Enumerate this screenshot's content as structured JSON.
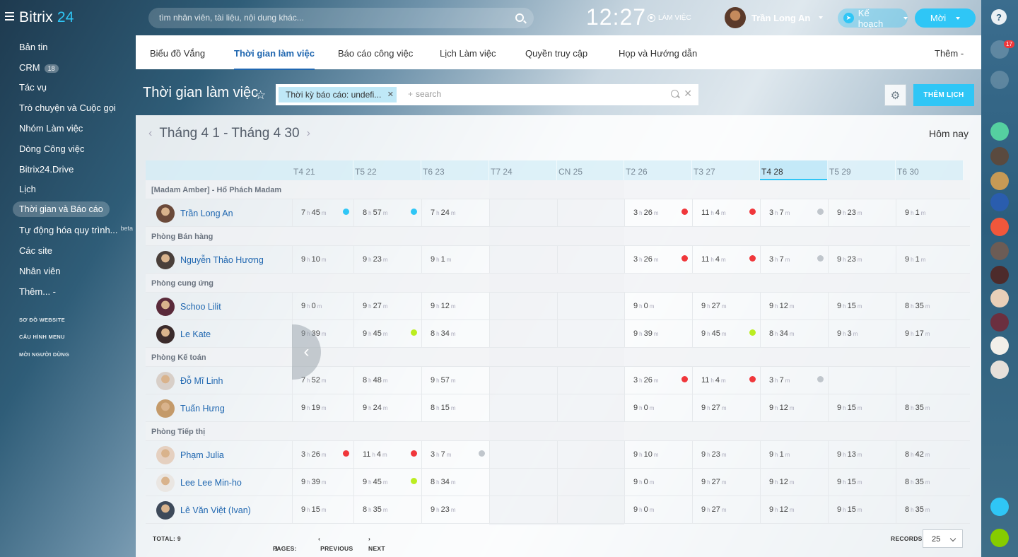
{
  "app": {
    "logo_main": "Bitrix",
    "logo_num": "24"
  },
  "top": {
    "search_placeholder": "tìm nhân viên, tài liệu, nội dung khác...",
    "clock": "12:27",
    "work_status": "LÀM VIỆC",
    "user_name": "Trần Long An",
    "plan_label": "Kế hoạch",
    "new_label": "Mời",
    "help_label": "?",
    "notif_count": "17"
  },
  "menu": {
    "items": [
      {
        "label": "Bản tin"
      },
      {
        "label": "CRM",
        "badge": "18"
      },
      {
        "label": "Tác vụ"
      },
      {
        "label": "Trò chuyện và Cuộc gọi"
      },
      {
        "label": "Nhóm Làm việc"
      },
      {
        "label": "Dòng Công việc"
      },
      {
        "label": "Bitrix24.Drive"
      },
      {
        "label": "Lịch"
      },
      {
        "label": "Thời gian và Báo cáo"
      },
      {
        "label": "Tự động hóa quy trình...",
        "beta": "beta"
      },
      {
        "label": "Các site"
      },
      {
        "label": "Nhân viên"
      },
      {
        "label": "Thêm... -"
      }
    ],
    "small": [
      "SƠ ĐỒ WEBSITE",
      "CẤU HÌNH MENU",
      "MỜI NGƯỜI DÙNG"
    ]
  },
  "tabs": [
    "Biểu đồ Vắng",
    "Thời gian làm việc",
    "Báo cáo công việc",
    "Lịch Làm việc",
    "Quyền truy cập",
    "Họp và Hướng dẫn",
    "Thêm -"
  ],
  "page": {
    "title": "Thời gian làm việc",
    "filter_chip": "Thời kỳ báo cáo: undefi...",
    "filter_placeholder": "search",
    "add_button": "THÊM LỊCH",
    "range": "Tháng 4 1 - Tháng 4 30",
    "today": "Hôm nay"
  },
  "days": [
    "T4 21",
    "T5 22",
    "T6 23",
    "T7 24",
    "CN 25",
    "T2 26",
    "T3 27",
    "T4 28",
    "T5 29",
    "T6 30"
  ],
  "groups": [
    {
      "name": "[Madam Amber] - Hổ Phách Madam",
      "employees": [
        {
          "name": "Trần Long An",
          "cells": [
            [
              "7",
              "45",
              "blue"
            ],
            [
              "8",
              "57",
              "blue"
            ],
            [
              "7",
              "24",
              ""
            ],
            null,
            null,
            [
              "3",
              "26",
              "red"
            ],
            [
              "11",
              "4",
              "red"
            ],
            [
              "3",
              "7",
              "gray"
            ],
            [
              "9",
              "23",
              ""
            ],
            [
              "9",
              "1",
              ""
            ]
          ]
        }
      ]
    },
    {
      "name": "Phòng Bán hàng",
      "employees": [
        {
          "name": "Nguyễn Thảo Hương",
          "cells": [
            [
              "9",
              "10",
              ""
            ],
            [
              "9",
              "23",
              ""
            ],
            [
              "9",
              "1",
              ""
            ],
            null,
            null,
            [
              "3",
              "26",
              "red"
            ],
            [
              "11",
              "4",
              "red"
            ],
            [
              "3",
              "7",
              "gray"
            ],
            [
              "9",
              "23",
              ""
            ],
            [
              "9",
              "1",
              ""
            ]
          ]
        }
      ]
    },
    {
      "name": "Phòng cung ứng",
      "employees": [
        {
          "name": "Schoo Lilit",
          "cells": [
            [
              "9",
              "0",
              ""
            ],
            [
              "9",
              "27",
              ""
            ],
            [
              "9",
              "12",
              ""
            ],
            null,
            null,
            [
              "9",
              "0",
              ""
            ],
            [
              "9",
              "27",
              ""
            ],
            [
              "9",
              "12",
              ""
            ],
            [
              "9",
              "15",
              ""
            ],
            [
              "8",
              "35",
              ""
            ]
          ]
        },
        {
          "name": "Le Kate",
          "cells": [
            [
              "9",
              "39",
              ""
            ],
            [
              "9",
              "45",
              "lime"
            ],
            [
              "8",
              "34",
              ""
            ],
            null,
            null,
            [
              "9",
              "39",
              ""
            ],
            [
              "9",
              "45",
              "lime"
            ],
            [
              "8",
              "34",
              ""
            ],
            [
              "9",
              "3",
              ""
            ],
            [
              "9",
              "17",
              ""
            ]
          ]
        }
      ]
    },
    {
      "name": "Phòng Kế toán",
      "employees": [
        {
          "name": "Đỗ Mĩ Linh",
          "cells": [
            [
              "7",
              "52",
              ""
            ],
            [
              "8",
              "48",
              ""
            ],
            [
              "9",
              "57",
              ""
            ],
            null,
            null,
            [
              "3",
              "26",
              "red"
            ],
            [
              "11",
              "4",
              "red"
            ],
            [
              "3",
              "7",
              "gray"
            ],
            null,
            null
          ]
        },
        {
          "name": "Tuấn Hưng",
          "cells": [
            [
              "9",
              "19",
              ""
            ],
            [
              "9",
              "24",
              ""
            ],
            [
              "8",
              "15",
              ""
            ],
            null,
            null,
            [
              "9",
              "0",
              ""
            ],
            [
              "9",
              "27",
              ""
            ],
            [
              "9",
              "12",
              ""
            ],
            [
              "9",
              "15",
              ""
            ],
            [
              "8",
              "35",
              ""
            ]
          ]
        }
      ]
    },
    {
      "name": "Phòng Tiếp thị",
      "employees": [
        {
          "name": "Phạm Julia",
          "cells": [
            [
              "3",
              "26",
              "red"
            ],
            [
              "11",
              "4",
              "red"
            ],
            [
              "3",
              "7",
              "gray"
            ],
            null,
            null,
            [
              "9",
              "10",
              ""
            ],
            [
              "9",
              "23",
              ""
            ],
            [
              "9",
              "1",
              ""
            ],
            [
              "9",
              "13",
              ""
            ],
            [
              "8",
              "42",
              ""
            ]
          ]
        },
        {
          "name": "Lee Lee Min-ho",
          "cells": [
            [
              "9",
              "39",
              ""
            ],
            [
              "9",
              "45",
              "lime"
            ],
            [
              "8",
              "34",
              ""
            ],
            null,
            null,
            [
              "9",
              "0",
              ""
            ],
            [
              "9",
              "27",
              ""
            ],
            [
              "9",
              "12",
              ""
            ],
            [
              "9",
              "15",
              ""
            ],
            [
              "8",
              "35",
              ""
            ]
          ]
        },
        {
          "name": "Lê Văn Việt (Ivan)",
          "cells": [
            [
              "9",
              "15",
              ""
            ],
            [
              "8",
              "35",
              ""
            ],
            [
              "9",
              "23",
              ""
            ],
            null,
            null,
            [
              "9",
              "0",
              ""
            ],
            [
              "9",
              "27",
              ""
            ],
            [
              "9",
              "12",
              ""
            ],
            [
              "9",
              "15",
              ""
            ],
            [
              "8",
              "35",
              ""
            ]
          ]
        }
      ]
    }
  ],
  "units": {
    "h": "h",
    "m": "m"
  },
  "footer": {
    "total": "TOTAL: 9",
    "pages_label": "PAGES:",
    "pages": "1",
    "previous": "PREVIOUS",
    "next": "NEXT",
    "records_label": "RECORDS:",
    "records": "25"
  },
  "colors": {
    "accent": "#2fc6f6",
    "link": "#2067b0",
    "red": "#f0373b"
  }
}
